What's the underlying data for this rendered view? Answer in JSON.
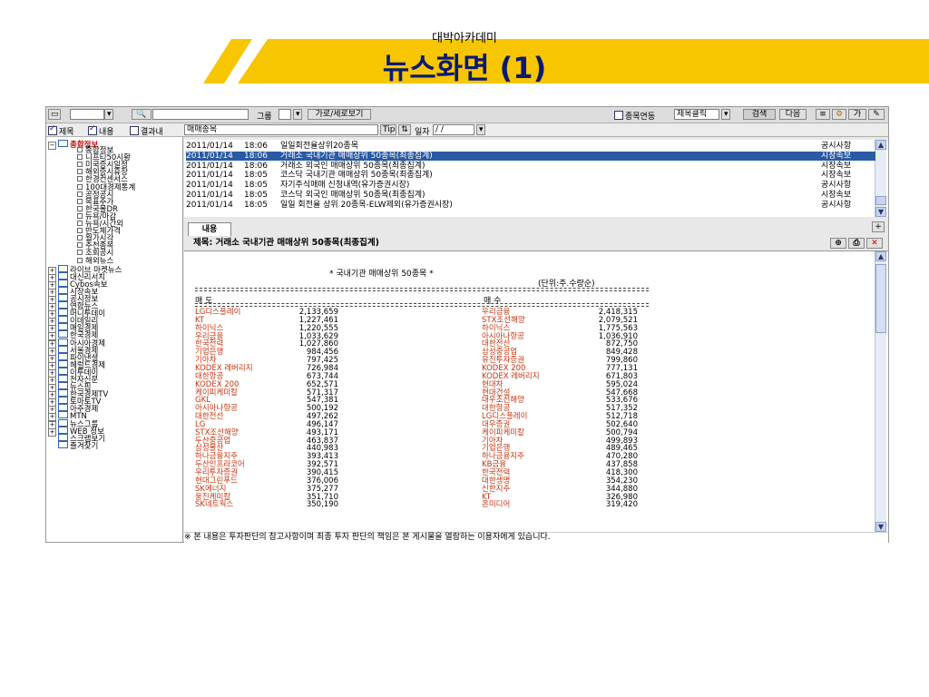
{
  "slide": {
    "subtitle": "대박아카데미",
    "title": "뉴스화면 (1)"
  },
  "colors": {
    "accent": "#f7c600",
    "title": "#0a1a70",
    "selection": "#2a5aa6",
    "stock_name": "#c8320c"
  },
  "toolbar": {
    "group_label": "그룹",
    "layout_button": "가로/세로보기",
    "link_label": "종목연동",
    "search_mode": "제목클릭",
    "search_button": "검색",
    "next_button": "다음",
    "char_label": "가"
  },
  "filter": {
    "title_check": "제목",
    "content_check": "내용",
    "result_check": "결과내",
    "keyword": "매매종목",
    "tip_label": "Tip",
    "date_label": "일자",
    "date_value": " /  / "
  },
  "tree": {
    "items": [
      {
        "label": "종합정보",
        "kind": "root-open"
      },
      {
        "label": "종합정보",
        "kind": "leaf"
      },
      {
        "label": "니프티50시황",
        "kind": "leaf"
      },
      {
        "label": "미국증시일정",
        "kind": "leaf"
      },
      {
        "label": "해외증시휴장",
        "kind": "leaf"
      },
      {
        "label": "한경컨센서스",
        "kind": "leaf"
      },
      {
        "label": "100대경제통계",
        "kind": "leaf"
      },
      {
        "label": "공정공시",
        "kind": "leaf"
      },
      {
        "label": "목표주가",
        "kind": "leaf"
      },
      {
        "label": "한국물DR",
        "kind": "leaf"
      },
      {
        "label": "뉴욕/마감",
        "kind": "leaf"
      },
      {
        "label": "뉴욕/시간외",
        "kind": "leaf"
      },
      {
        "label": "반도체가격",
        "kind": "leaf"
      },
      {
        "label": "월가시각",
        "kind": "leaf"
      },
      {
        "label": "추천종목",
        "kind": "leaf"
      },
      {
        "label": "조회공시",
        "kind": "leaf"
      },
      {
        "label": "해외뉴스",
        "kind": "leaf"
      },
      {
        "label": "라이브 마켓뉴스",
        "kind": "folder"
      },
      {
        "label": "대신리서치",
        "kind": "folder"
      },
      {
        "label": "Cybos속보",
        "kind": "folder"
      },
      {
        "label": "시장속보",
        "kind": "folder"
      },
      {
        "label": "공시정보",
        "kind": "folder"
      },
      {
        "label": "연합뉴스",
        "kind": "folder"
      },
      {
        "label": "머니투데이",
        "kind": "folder"
      },
      {
        "label": "이데일리",
        "kind": "folder"
      },
      {
        "label": "매일경제",
        "kind": "folder"
      },
      {
        "label": "한국경제",
        "kind": "folder"
      },
      {
        "label": "아시아경제",
        "kind": "folder"
      },
      {
        "label": "서울경제",
        "kind": "folder"
      },
      {
        "label": "파이낸셜",
        "kind": "folder"
      },
      {
        "label": "헤럴드경제",
        "kind": "folder"
      },
      {
        "label": "이투데이",
        "kind": "folder"
      },
      {
        "label": "전자신문",
        "kind": "folder"
      },
      {
        "label": "뉴스핌",
        "kind": "folder"
      },
      {
        "label": "한국경제TV",
        "kind": "folder"
      },
      {
        "label": "토마토TV",
        "kind": "folder"
      },
      {
        "label": "아주경제",
        "kind": "folder"
      },
      {
        "label": "MTN",
        "kind": "folder"
      },
      {
        "label": "뉴스그룹",
        "kind": "folder"
      },
      {
        "label": "WEB 정보",
        "kind": "folder"
      },
      {
        "label": "스크랩보기",
        "kind": "folder-noexp"
      },
      {
        "label": "즐겨찾기",
        "kind": "folder-noexp"
      }
    ]
  },
  "news_list": [
    {
      "date": "2011/01/14",
      "time": "18:06",
      "title": "일일회전율상위20종목",
      "source": "공시사항",
      "selected": false
    },
    {
      "date": "2011/01/14",
      "time": "18:06",
      "title": "거래소 국내기관 매매상위 50종목(최종집계)",
      "source": "시장속보",
      "selected": true
    },
    {
      "date": "2011/01/14",
      "time": "18:06",
      "title": "거래소 외국인 매매상위 50종목(최종집계)",
      "source": "시장속보",
      "selected": false
    },
    {
      "date": "2011/01/14",
      "time": "18:05",
      "title": "코스닥 국내기관 매매상위 50종목(최종집계)",
      "source": "시장속보",
      "selected": false
    },
    {
      "date": "2011/01/14",
      "time": "18:05",
      "title": "자기주식매매 신청내역(유가증권시장)",
      "source": "공시사항",
      "selected": false
    },
    {
      "date": "2011/01/14",
      "time": "18:05",
      "title": "코스닥 외국인 매매상위 50종목(최종집계)",
      "source": "시장속보",
      "selected": false
    },
    {
      "date": "2011/01/14",
      "time": "18:05",
      "title": "일일 회전율 상위 20종목-ELW제외(유가증권시장)",
      "source": "공시사항",
      "selected": false
    }
  ],
  "detail": {
    "tab": "내용",
    "subject": "제목: 거래소 국내기관 매매상위 50종목(최종집계)",
    "heading": "* 국내기관 매매상위 50종목 *",
    "unit": "(단위:주.수량순)",
    "sell_header": "매  도",
    "buy_header": "매  수",
    "sell": [
      [
        "LG디스플레이",
        "2,133,659"
      ],
      [
        "KT",
        "1,227,461"
      ],
      [
        "하이닉스",
        "1,220,555"
      ],
      [
        "우리금융",
        "1,033,629"
      ],
      [
        "한국전력",
        "1,027,860"
      ],
      [
        "기업은행",
        "984,456"
      ],
      [
        "기아차",
        "797,425"
      ],
      [
        "KODEX 레버리지",
        "726,984"
      ],
      [
        "대한항공",
        "673,744"
      ],
      [
        "KODEX 200",
        "652,571"
      ],
      [
        "케이피케미칼",
        "571,317"
      ],
      [
        "GKL",
        "547,381"
      ],
      [
        "아시아나항공",
        "500,192"
      ],
      [
        "대한전선",
        "497,262"
      ],
      [
        "LG",
        "496,147"
      ],
      [
        "STX조선해양",
        "493,171"
      ],
      [
        "두산중공업",
        "463,837"
      ],
      [
        "삼성물산",
        "440,983"
      ],
      [
        "하나금융지주",
        "393,413"
      ],
      [
        "두산인프라코어",
        "392,571"
      ],
      [
        "우리투자증권",
        "390,415"
      ],
      [
        "현대그린푸드",
        "376,006"
      ],
      [
        "SK에너지",
        "375,277"
      ],
      [
        "웅진케미칼",
        "351,710"
      ],
      [
        "SK네트웍스",
        "350,190"
      ]
    ],
    "buy": [
      [
        "우리금융",
        "2,418,315"
      ],
      [
        "STX조선해양",
        "2,079,521"
      ],
      [
        "하이닉스",
        "1,775,563"
      ],
      [
        "아시아나항공",
        "1,036,910"
      ],
      [
        "대한전선",
        "872,750"
      ],
      [
        "삼성중공업",
        "849,428"
      ],
      [
        "유진투자증권",
        "799,860"
      ],
      [
        "KODEX 200",
        "777,131"
      ],
      [
        "KODEX 레버리지",
        "671,803"
      ],
      [
        "현대차",
        "595,024"
      ],
      [
        "현대건설",
        "547,668"
      ],
      [
        "대우조선해양",
        "533,676"
      ],
      [
        "대한항공",
        "517,352"
      ],
      [
        "LG디스플레이",
        "512,718"
      ],
      [
        "대우증권",
        "502,640"
      ],
      [
        "케이피케미칼",
        "500,794"
      ],
      [
        "기아차",
        "499,893"
      ],
      [
        "기업은행",
        "489,465"
      ],
      [
        "하나금융지주",
        "470,280"
      ],
      [
        "KB금융",
        "437,858"
      ],
      [
        "한국전력",
        "418,300"
      ],
      [
        "대한생명",
        "354,230"
      ],
      [
        "신한지주",
        "344,880"
      ],
      [
        "KT",
        "326,980"
      ],
      [
        "온미디어",
        "319,420"
      ]
    ],
    "footer": "※ 본 내용은 투자판단의 참고사항이며 최종 투자 판단의 책임은 본 게시물을 열람하는 이용자에게 있습니다."
  }
}
